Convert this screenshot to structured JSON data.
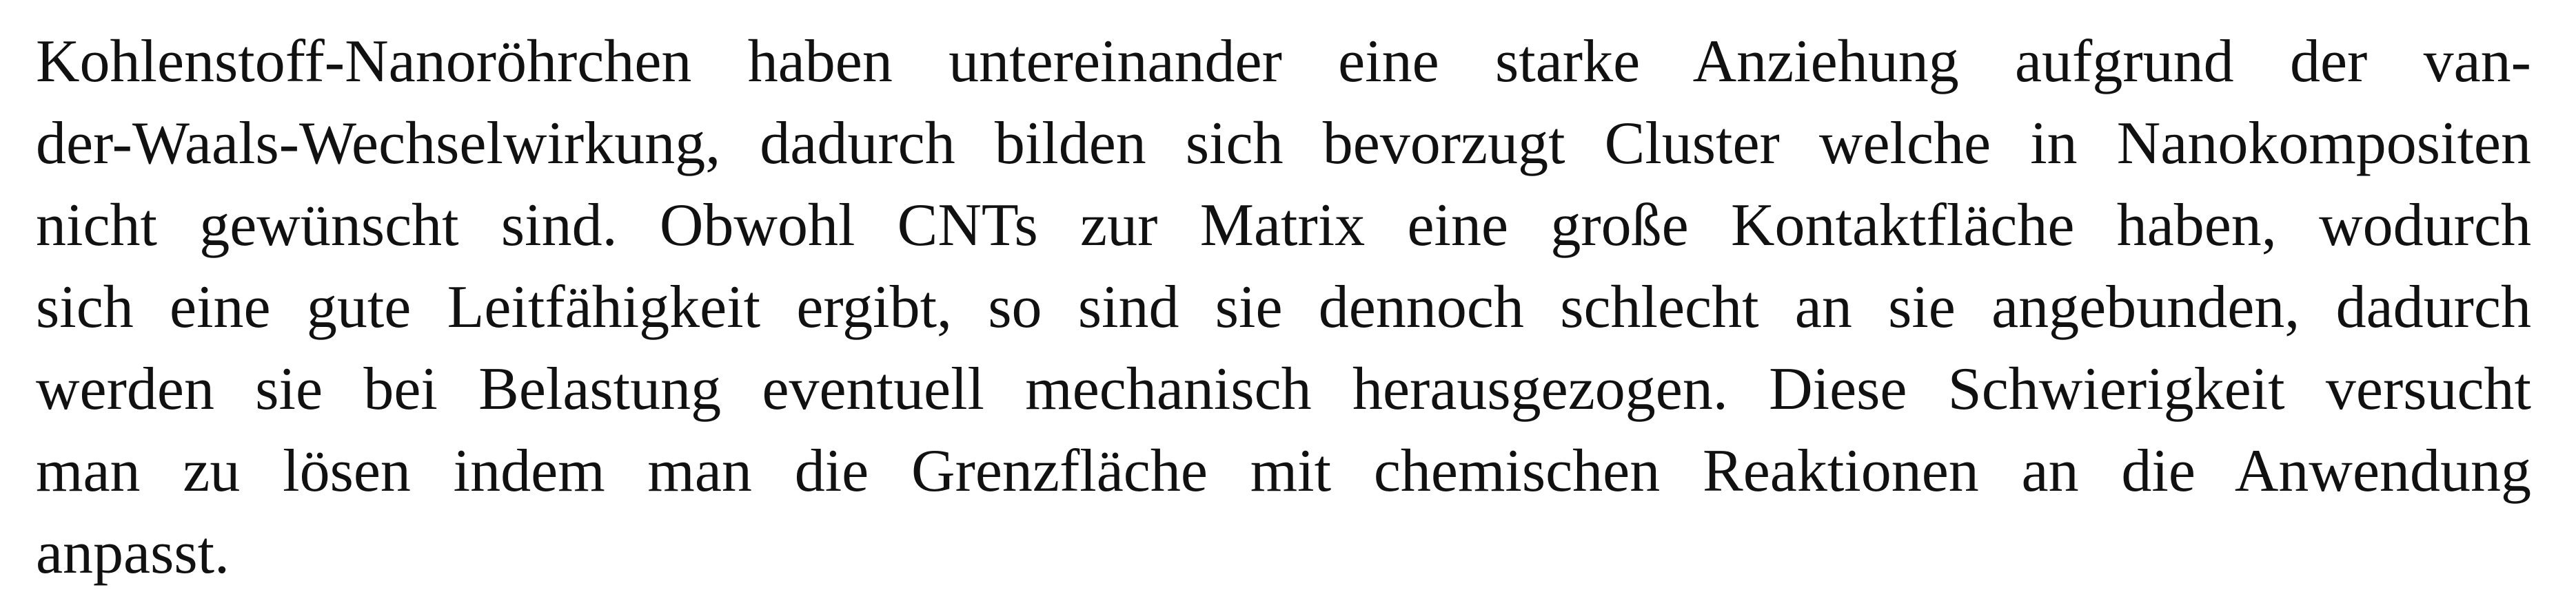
{
  "paragraph": {
    "lines": [
      "Kohlenstoff-Nanoröhrchen haben untereinander eine starke Anziehung aufgrund der van-",
      "der-Waals-Wechselwirkung, dadurch bilden sich bevorzugt Cluster welche in Nanokompositen",
      "nicht gewünscht sind. Obwohl CNTs zur Matrix eine große Kontaktfläche haben, wodurch",
      "sich eine gute Leitfähigkeit ergibt, so sind sie dennoch schlecht an sie angebunden, dadurch",
      "werden sie bei Belastung eventuell mechanisch herausgezogen. Diese Schwierigkeit versucht",
      "man zu lösen indem man die Grenzfläche mit chemischen Reaktionen an die Anwendung",
      "anpasst."
    ]
  }
}
